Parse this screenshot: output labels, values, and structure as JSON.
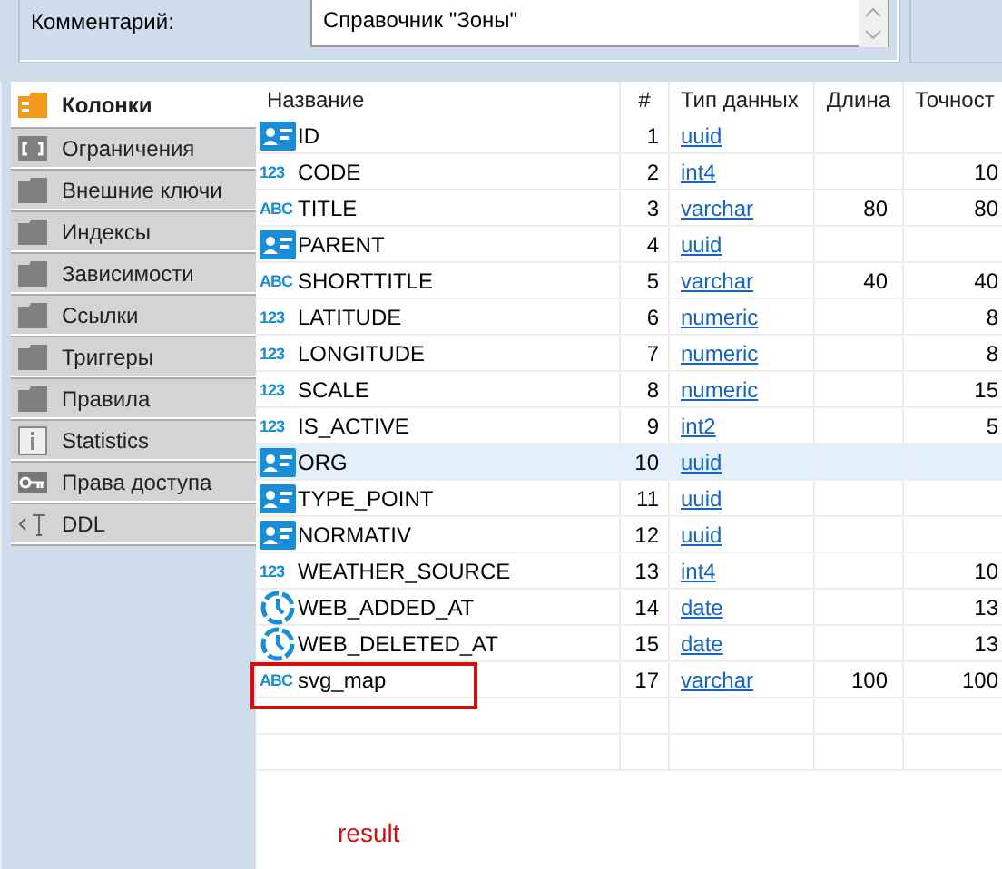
{
  "comment": {
    "label": "Комментарий:",
    "value": "Справочник \"Зоны\""
  },
  "sidebar": {
    "items": [
      {
        "label": "Колонки",
        "kind": "columns",
        "selected": true
      },
      {
        "label": "Ограничения",
        "kind": "constraint",
        "selected": false
      },
      {
        "label": "Внешние ключи",
        "kind": "folder",
        "selected": false
      },
      {
        "label": "Индексы",
        "kind": "folder",
        "selected": false
      },
      {
        "label": "Зависимости",
        "kind": "folder",
        "selected": false
      },
      {
        "label": "Ссылки",
        "kind": "folder",
        "selected": false
      },
      {
        "label": "Триггеры",
        "kind": "folder",
        "selected": false
      },
      {
        "label": "Правила",
        "kind": "folder",
        "selected": false
      },
      {
        "label": "Statistics",
        "kind": "info",
        "selected": false
      },
      {
        "label": "Права доступа",
        "kind": "key",
        "selected": false
      },
      {
        "label": "DDL",
        "kind": "ddl",
        "selected": false
      }
    ]
  },
  "table": {
    "columns": [
      "Название",
      "#",
      "Тип данных",
      "Длина",
      "Точност"
    ],
    "rows": [
      {
        "kind": "ref",
        "name": "ID",
        "num": "1",
        "type": "uuid",
        "selected": false
      },
      {
        "kind": "num",
        "badge": "123",
        "name": "CODE",
        "num": "2",
        "type": "int4",
        "precision": "10",
        "selected": false
      },
      {
        "kind": "str",
        "badge": "ABC",
        "name": "TITLE",
        "num": "3",
        "type": "varchar",
        "length": "80",
        "precision": "80",
        "selected": false
      },
      {
        "kind": "ref",
        "name": "PARENT",
        "num": "4",
        "type": "uuid",
        "selected": false
      },
      {
        "kind": "str",
        "badge": "ABC",
        "name": "SHORTTITLE",
        "num": "5",
        "type": "varchar",
        "length": "40",
        "precision": "40",
        "selected": false
      },
      {
        "kind": "num",
        "badge": "123",
        "name": "LATITUDE",
        "num": "6",
        "type": "numeric",
        "precision": "8",
        "selected": false
      },
      {
        "kind": "num",
        "badge": "123",
        "name": "LONGITUDE",
        "num": "7",
        "type": "numeric",
        "precision": "8",
        "selected": false
      },
      {
        "kind": "num",
        "badge": "123",
        "name": "SCALE",
        "num": "8",
        "type": "numeric",
        "precision": "15",
        "selected": false
      },
      {
        "kind": "num",
        "badge": "123",
        "name": "IS_ACTIVE",
        "num": "9",
        "type": "int2",
        "precision": "5",
        "selected": false
      },
      {
        "kind": "ref",
        "name": "ORG",
        "num": "10",
        "type": "uuid",
        "selected": true
      },
      {
        "kind": "ref",
        "name": "TYPE_POINT",
        "num": "11",
        "type": "uuid",
        "selected": false
      },
      {
        "kind": "ref",
        "name": "NORMATIV",
        "num": "12",
        "type": "uuid",
        "selected": false
      },
      {
        "kind": "num",
        "badge": "123",
        "name": "WEATHER_SOURCE",
        "num": "13",
        "type": "int4",
        "precision": "10",
        "selected": false
      },
      {
        "kind": "date",
        "name": "WEB_ADDED_AT",
        "num": "14",
        "type": "date",
        "precision": "13",
        "selected": false
      },
      {
        "kind": "date",
        "name": "WEB_DELETED_AT",
        "num": "15",
        "type": "date",
        "precision": "13",
        "selected": false
      },
      {
        "kind": "str",
        "badge": "ABC",
        "name": "svg_map",
        "num": "17",
        "type": "varchar",
        "length": "100",
        "precision": "100",
        "selected": false,
        "highlighted": true
      }
    ]
  },
  "annotation": {
    "text": "result"
  }
}
